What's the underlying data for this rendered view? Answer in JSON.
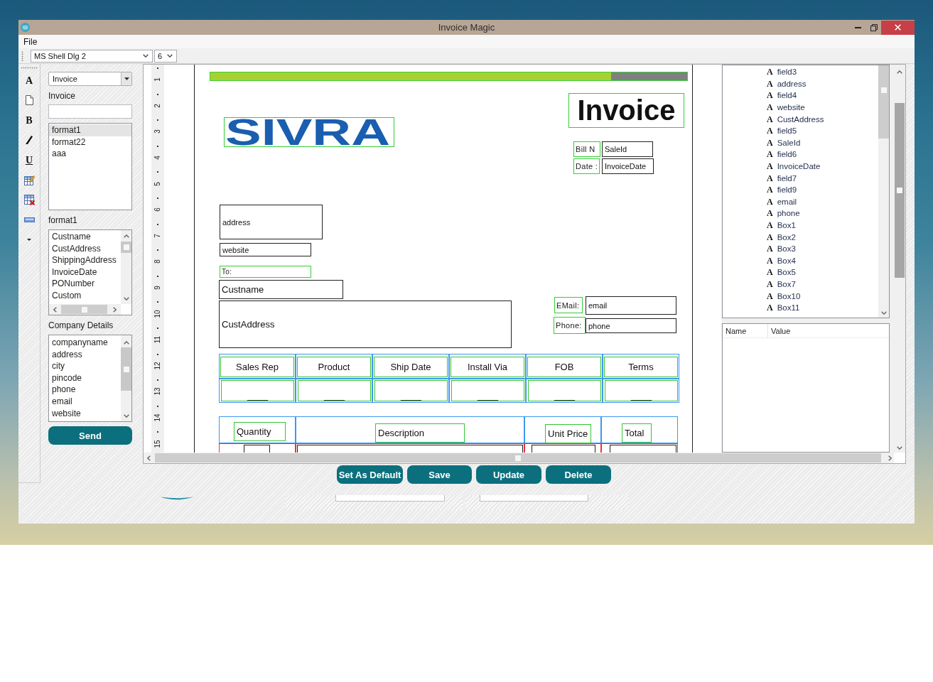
{
  "window": {
    "title": "Invoice Magic"
  },
  "menu": [
    {
      "label": "File"
    }
  ],
  "format_bar": {
    "font": "MS Shell Dlg 2",
    "size": "6"
  },
  "side_tools": [
    {
      "kind": "font",
      "glyph": "A"
    },
    {
      "kind": "page"
    },
    {
      "kind": "bold",
      "glyph": "B"
    },
    {
      "kind": "italic"
    },
    {
      "kind": "underline",
      "glyph": "U"
    },
    {
      "kind": "table-edit"
    },
    {
      "kind": "table-delete"
    },
    {
      "kind": "bar"
    },
    {
      "kind": "dropdown"
    }
  ],
  "left_panel": {
    "document_type": "Invoice",
    "document_label": "Invoice",
    "formats": [
      {
        "label": "format1",
        "selected": true
      },
      {
        "label": "format22",
        "selected": false
      },
      {
        "label": "aaa",
        "selected": false
      }
    ],
    "format_label": "format1",
    "format_fields": [
      {
        "label": "Custname",
        "selected": false
      },
      {
        "label": "CustAddress",
        "selected": false
      },
      {
        "label": "ShippingAddress",
        "selected": false
      },
      {
        "label": "InvoiceDate",
        "selected": false
      },
      {
        "label": "PONumber",
        "selected": false
      },
      {
        "label": "Custom",
        "selected": false
      }
    ],
    "company_label": "Company Details",
    "company_fields": [
      {
        "label": "companyname",
        "selected": false
      },
      {
        "label": "address",
        "selected": false
      },
      {
        "label": "city",
        "selected": false
      },
      {
        "label": "pincode",
        "selected": false
      },
      {
        "label": "phone",
        "selected": false
      },
      {
        "label": "email",
        "selected": false
      },
      {
        "label": "website",
        "selected": false
      }
    ],
    "send_button": "Send"
  },
  "designer": {
    "ruler": [
      "1",
      "2",
      "3",
      "4",
      "5",
      "6",
      "7",
      "8",
      "9",
      "10",
      "11",
      "12",
      "13",
      "14",
      "15"
    ],
    "page": {
      "logo": "SIVRA",
      "title": "Invoice",
      "bill_no": {
        "label": "Bill N",
        "value": "SaleId"
      },
      "date": {
        "label": "Date :",
        "value": "InvoiceDate"
      },
      "address": "address",
      "website": "website",
      "to_label": "To:",
      "customer_name": "Custname",
      "customer_address": "CustAddress",
      "email": {
        "label": "EMail:",
        "value": "email"
      },
      "phone": {
        "label": "Phone:",
        "value": "phone"
      },
      "order_table": [
        {
          "header": "Sales Rep",
          "value": "____"
        },
        {
          "header": "Product",
          "value": "____"
        },
        {
          "header": "Ship Date",
          "value": "____"
        },
        {
          "header": "Install Via",
          "value": "____"
        },
        {
          "header": "FOB",
          "value": "____"
        },
        {
          "header": "Terms",
          "value": "____"
        }
      ],
      "items_table": [
        {
          "header": "Quantity"
        },
        {
          "header": "Description"
        },
        {
          "header": "Unit Price"
        },
        {
          "header": "Total"
        }
      ]
    },
    "fields_tree": [
      {
        "glyph": "A",
        "label": "field3",
        "selected": false
      },
      {
        "glyph": "A",
        "label": "address",
        "selected": false
      },
      {
        "glyph": "A",
        "label": "field4",
        "selected": false
      },
      {
        "glyph": "A",
        "label": "website",
        "selected": false
      },
      {
        "glyph": "A",
        "label": "CustAddress",
        "selected": false
      },
      {
        "glyph": "A",
        "label": "field5",
        "selected": false
      },
      {
        "glyph": "A",
        "label": "SaleId",
        "selected": false
      },
      {
        "glyph": "A",
        "label": "field6",
        "selected": false
      },
      {
        "glyph": "A",
        "label": "InvoiceDate",
        "selected": false
      },
      {
        "glyph": "A",
        "label": "field7",
        "selected": false
      },
      {
        "glyph": "A",
        "label": "field9",
        "selected": false
      },
      {
        "glyph": "A",
        "label": "email",
        "selected": false
      },
      {
        "glyph": "A",
        "label": "phone",
        "selected": false
      },
      {
        "glyph": "A",
        "label": "Box1",
        "selected": false
      },
      {
        "glyph": "A",
        "label": "Box2",
        "selected": false
      },
      {
        "glyph": "A",
        "label": "Box3",
        "selected": false
      },
      {
        "glyph": "A",
        "label": "Box4",
        "selected": false
      },
      {
        "glyph": "A",
        "label": "Box5",
        "selected": false
      },
      {
        "glyph": "A",
        "label": "Box7",
        "selected": false
      },
      {
        "glyph": "A",
        "label": "Box10",
        "selected": false
      },
      {
        "glyph": "A",
        "label": "Box11",
        "selected": false
      }
    ],
    "properties": {
      "columns": [
        "Name",
        "Value"
      ]
    }
  },
  "actions": [
    {
      "label": "Set As Default"
    },
    {
      "label": "Save"
    },
    {
      "label": "Update"
    },
    {
      "label": "Delete"
    }
  ]
}
